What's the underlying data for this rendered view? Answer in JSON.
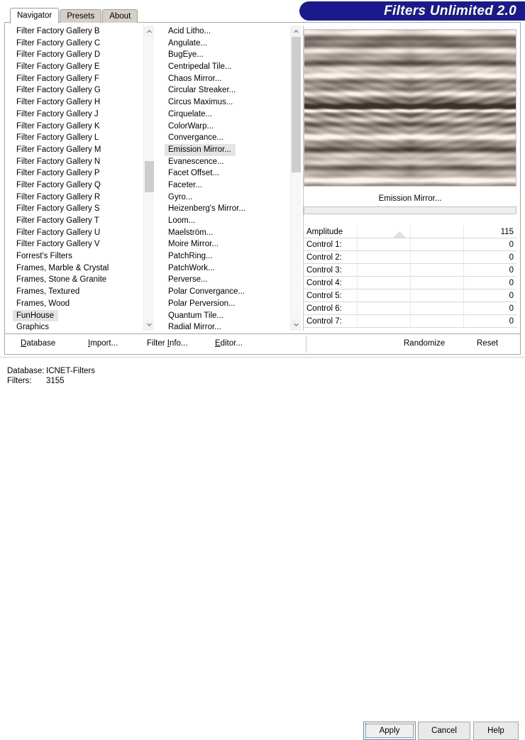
{
  "app": {
    "brand_title": "Filters Unlimited 2.0"
  },
  "tabs": [
    {
      "label": "Navigator",
      "active": true
    },
    {
      "label": "Presets",
      "active": false
    },
    {
      "label": "About",
      "active": false
    }
  ],
  "category_list": {
    "selected": "FunHouse",
    "items": [
      "Filter Factory Gallery B",
      "Filter Factory Gallery C",
      "Filter Factory Gallery D",
      "Filter Factory Gallery E",
      "Filter Factory Gallery F",
      "Filter Factory Gallery G",
      "Filter Factory Gallery H",
      "Filter Factory Gallery J",
      "Filter Factory Gallery K",
      "Filter Factory Gallery L",
      "Filter Factory Gallery M",
      "Filter Factory Gallery N",
      "Filter Factory Gallery P",
      "Filter Factory Gallery Q",
      "Filter Factory Gallery R",
      "Filter Factory Gallery S",
      "Filter Factory Gallery T",
      "Filter Factory Gallery U",
      "Filter Factory Gallery V",
      "Forrest's Filters",
      "Frames, Marble & Crystal",
      "Frames, Stone & Granite",
      "Frames, Textured",
      "Frames, Wood",
      "FunHouse",
      "Graphics"
    ]
  },
  "filter_list": {
    "selected": "Emission Mirror...",
    "items": [
      "Acid Litho...",
      "Angulate...",
      "BugEye...",
      "Centripedal Tile...",
      "Chaos Mirror...",
      "Circular Streaker...",
      "Circus Maximus...",
      "Cirquelate...",
      "ColorWarp...",
      "Convergance...",
      "Emission Mirror...",
      "Evanescence...",
      "Facet Offset...",
      "Faceter...",
      "Gyro...",
      "Heizenberg's Mirror...",
      "Loom...",
      "Maelström...",
      "Moire Mirror...",
      "PatchRing...",
      "PatchWork...",
      "Perverse...",
      "Polar Convergance...",
      "Polar Perversion...",
      "Quantum Tile...",
      "Radial Mirror..."
    ]
  },
  "preview": {
    "filter_name": "Emission Mirror...",
    "progress_percent": 0
  },
  "parameters": [
    {
      "name": "Amplitude",
      "value": "115",
      "has_slider": true,
      "slider_percent": 45
    },
    {
      "name": "Control 1:",
      "value": "0",
      "has_slider": false,
      "slider_percent": 0
    },
    {
      "name": "Control 2:",
      "value": "0",
      "has_slider": false,
      "slider_percent": 0
    },
    {
      "name": "Control 3:",
      "value": "0",
      "has_slider": false,
      "slider_percent": 0
    },
    {
      "name": "Control 4:",
      "value": "0",
      "has_slider": false,
      "slider_percent": 0
    },
    {
      "name": "Control 5:",
      "value": "0",
      "has_slider": false,
      "slider_percent": 0
    },
    {
      "name": "Control 6:",
      "value": "0",
      "has_slider": false,
      "slider_percent": 0
    },
    {
      "name": "Control 7:",
      "value": "0",
      "has_slider": false,
      "slider_percent": 0
    }
  ],
  "command_bar": {
    "database_label": "Database",
    "database_accel": "D",
    "import_label": "Import...",
    "import_accel": "I",
    "filter_info_label": "Filter Info...",
    "filter_info_accel": "I",
    "editor_label": "Editor...",
    "editor_accel": "E",
    "randomize_label": "Randomize",
    "reset_label": "Reset"
  },
  "status": {
    "database_key": "Database:",
    "database_value": "ICNET-Filters",
    "filters_key": "Filters:",
    "filters_value": "3155"
  },
  "dialog_buttons": {
    "apply_label": "Apply",
    "cancel_label": "Cancel",
    "help_label": "Help"
  },
  "colors": {
    "brand_blue": "#1a1a8c",
    "selection_gray": "#e4e4e4",
    "scroll_thumb": "#cdcdcd",
    "default_button_border": "#5b9ad1"
  },
  "scroll_state": {
    "category_thumb_top_percent": 44,
    "category_thumb_height_percent": 11,
    "filter_thumb_top_percent": 0,
    "filter_thumb_height_percent": 48
  }
}
